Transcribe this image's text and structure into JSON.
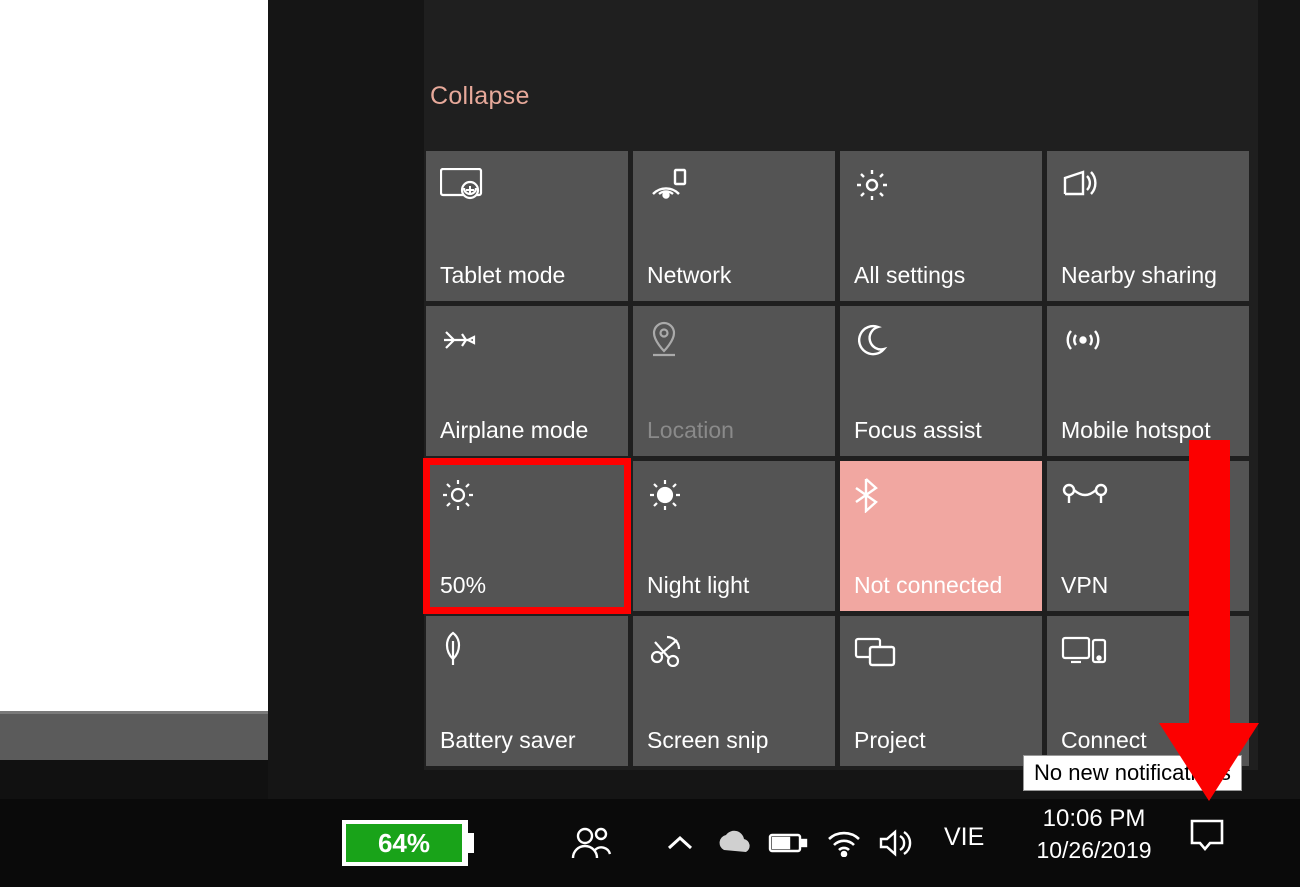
{
  "panel": {
    "collapse_label": "Collapse",
    "tiles": [
      {
        "label": "Tablet mode"
      },
      {
        "label": "Network"
      },
      {
        "label": "All settings"
      },
      {
        "label": "Nearby sharing"
      },
      {
        "label": "Airplane mode"
      },
      {
        "label": "Location"
      },
      {
        "label": "Focus assist"
      },
      {
        "label": "Mobile hotspot"
      },
      {
        "label": "50%"
      },
      {
        "label": "Night light"
      },
      {
        "label": "Not connected"
      },
      {
        "label": "VPN"
      },
      {
        "label": "Battery saver"
      },
      {
        "label": "Screen snip"
      },
      {
        "label": "Project"
      },
      {
        "label": "Connect"
      }
    ]
  },
  "taskbar": {
    "battery_percent": "64%",
    "ime": "VIE",
    "time": "10:06 PM",
    "date": "10/26/2019"
  },
  "tooltip": "No new notifications"
}
